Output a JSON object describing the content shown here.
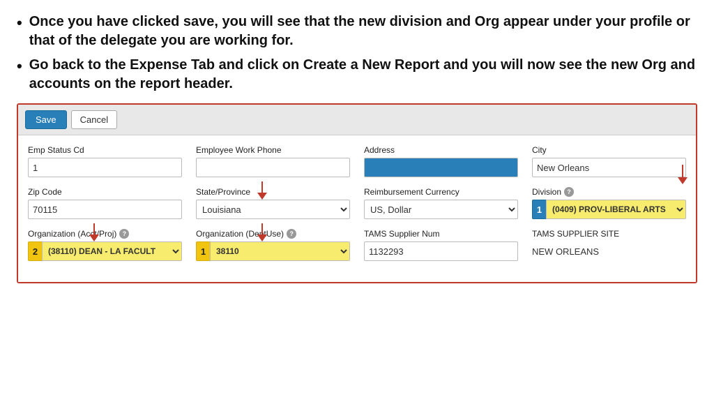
{
  "bullets": [
    {
      "id": "bullet-1",
      "text": "Once you have clicked save, you will see that the new division and Org appear under your profile or that of the delegate you are working for."
    },
    {
      "id": "bullet-2",
      "text": "Go back to the Expense Tab and click on Create a New Report and you will now see the new Org and accounts on the report header."
    }
  ],
  "toolbar": {
    "save_label": "Save",
    "cancel_label": "Cancel"
  },
  "form": {
    "row1": {
      "emp_status_label": "Emp Status Cd",
      "emp_status_value": "1",
      "emp_phone_label": "Employee Work Phone",
      "emp_phone_value": "",
      "address_label": "Address",
      "address_value": "",
      "city_label": "City",
      "city_value": "New Orleans"
    },
    "row2": {
      "zip_label": "Zip Code",
      "zip_value": "70115",
      "state_label": "State/Province",
      "state_value": "Louisiana",
      "currency_label": "Reimbursement Currency",
      "currency_value": "US, Dollar",
      "division_label": "Division",
      "division_badge": "1",
      "division_value": "(0409) PROV-LIBERAL ARTS"
    },
    "row3": {
      "org_acct_label": "Organization (Acct/Proj)",
      "org_acct_badge": "2",
      "org_acct_value": "(38110) DEAN - LA FACULT",
      "org_dept_label": "Organization (DeptUse)",
      "org_dept_badge": "1",
      "org_dept_value": "38110",
      "tams_num_label": "TAMS Supplier Num",
      "tams_num_value": "1132293",
      "tams_site_label": "TAMS SUPPLIER SITE",
      "tams_site_value": "NEW ORLEANS"
    }
  },
  "icons": {
    "help": "?",
    "dropdown": "▼"
  }
}
